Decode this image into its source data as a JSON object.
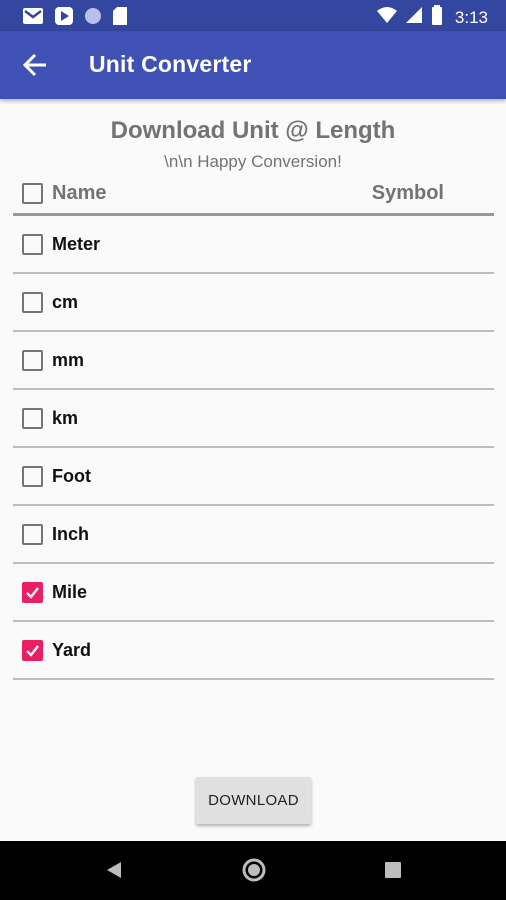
{
  "status_bar": {
    "time": "3:13",
    "icons": [
      "gmail-icon",
      "play-store-icon",
      "circle-icon",
      "sd-card-icon",
      "wifi-icon",
      "signal-icon",
      "battery-icon"
    ]
  },
  "app_bar": {
    "title": "Unit Converter",
    "back_icon": "arrow-back-icon",
    "color": "#3f51b5"
  },
  "content": {
    "heading": "Download Unit @ Length",
    "subtitle": "\\n\\n Happy Conversion!",
    "columns": {
      "name": "Name",
      "symbol": "Symbol"
    },
    "header_checked": false,
    "units": [
      {
        "label": "Meter",
        "checked": false
      },
      {
        "label": "cm",
        "checked": false
      },
      {
        "label": "mm",
        "checked": false
      },
      {
        "label": "km",
        "checked": false
      },
      {
        "label": "Foot",
        "checked": false
      },
      {
        "label": "Inch",
        "checked": false
      },
      {
        "label": "Mile",
        "checked": true
      },
      {
        "label": "Yard",
        "checked": true
      }
    ],
    "accent_color": "#e91e63"
  },
  "download_button": {
    "label": "DOWNLOAD"
  },
  "nav_bar": {
    "icons": [
      "back-triangle-icon",
      "home-circle-icon",
      "recents-square-icon"
    ]
  }
}
